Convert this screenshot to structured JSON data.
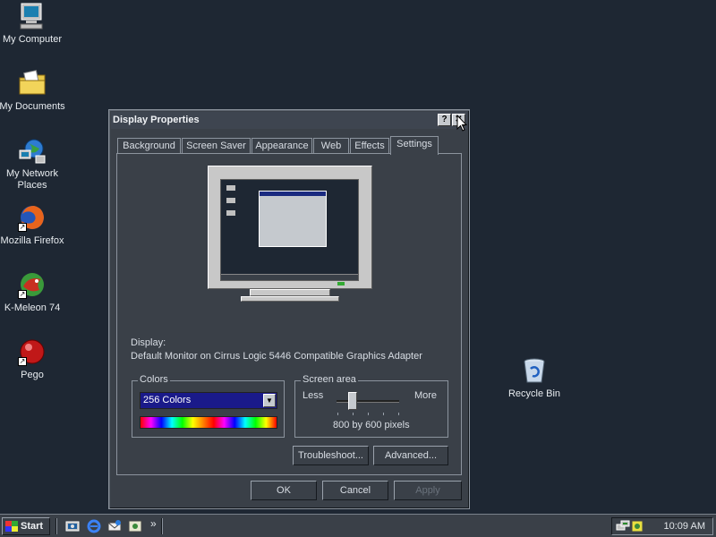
{
  "desktop": {
    "icons": [
      {
        "label": "My Computer",
        "icon": "computer-icon"
      },
      {
        "label": "My Documents",
        "icon": "folder-documents-icon"
      },
      {
        "label": "My Network Places",
        "icon": "network-icon"
      },
      {
        "label": "Mozilla Firefox",
        "icon": "firefox-icon"
      },
      {
        "label": "K-Meleon 74",
        "icon": "k-meleon-icon"
      },
      {
        "label": "Pego",
        "icon": "pego-icon"
      },
      {
        "label": "Recycle Bin",
        "icon": "recycle-bin-icon"
      }
    ]
  },
  "dialog": {
    "title": "Display Properties",
    "help_glyph": "?",
    "close_glyph": "✕",
    "tabs": [
      "Background",
      "Screen Saver",
      "Appearance",
      "Web",
      "Effects",
      "Settings"
    ],
    "active_tab": "Settings",
    "display_label": "Display:",
    "display_value": "Default Monitor on Cirrus Logic 5446 Compatible Graphics Adapter",
    "colors": {
      "legend": "Colors",
      "selected": "256 Colors"
    },
    "screen_area": {
      "legend": "Screen area",
      "less": "Less",
      "more": "More",
      "value_text": "800 by 600 pixels",
      "slider_fraction": 0.25
    },
    "buttons": {
      "troubleshoot": "Troubleshoot...",
      "advanced": "Advanced...",
      "ok": "OK",
      "cancel": "Cancel",
      "apply": "Apply"
    }
  },
  "taskbar": {
    "start_label": "Start",
    "chevron": "»",
    "clock": "10:09 AM",
    "quick_launch": [
      "show-desktop-icon",
      "ie-icon",
      "outlook-icon",
      "channels-icon"
    ]
  },
  "colors": {
    "desktop": "#1e2733",
    "dialog": "#3a4048",
    "select_highlight": "#1a1a8a"
  }
}
